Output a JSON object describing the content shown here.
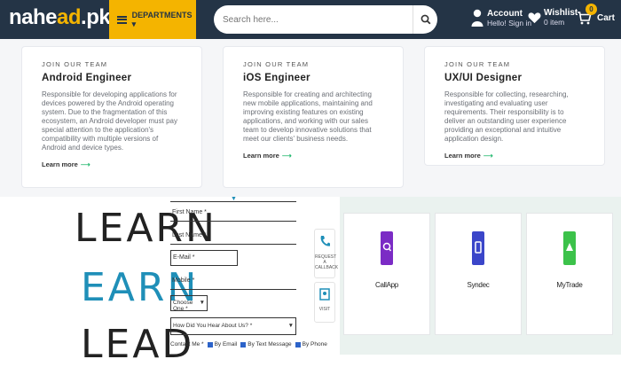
{
  "header": {
    "logo_main": "nahe",
    "logo_accent": "ad",
    "logo_tail": ".pk",
    "departments_label": "DEPARTMENTS ▾",
    "search_placeholder": "Search here...",
    "account_title": "Account",
    "account_sub": "Hello! Sign in",
    "wishlist_title": "Wishlist",
    "wishlist_sub": "0 item",
    "cart_label": "Cart",
    "cart_count": "0"
  },
  "jobs": [
    {
      "kicker": "JOIN OUR TEAM",
      "title": "Android Engineer",
      "desc": "Responsible for developing applications for devices powered by the Android operating system. Due to the fragmentation of this ecosystem, an Android developer must pay special attention to the application's compatibility with multiple versions of Android and device types.",
      "more": "Learn more"
    },
    {
      "kicker": "JOIN OUR TEAM",
      "title": "iOS Engineer",
      "desc": "Responsible for creating and architecting new mobile applications, maintaining and improving existing features on existing applications, and working with our sales team to develop innovative solutions that meet our clients' business needs.",
      "more": "Learn more"
    },
    {
      "kicker": "JOIN OUR TEAM",
      "title": "UX/UI Designer",
      "desc": "Responsible for collecting, researching, investigating and evaluating user requirements. Their responsibility is to deliver an outstanding user experience providing an exceptional and intuitive application design.",
      "more": "Learn more"
    }
  ],
  "promo": {
    "learn": "LEARN",
    "earn": "EARN",
    "lead": "LEAD"
  },
  "form": {
    "first_name": "First Name *",
    "last_name": "Last Name *",
    "email": "E-Mail *",
    "mobile": "Mobile *",
    "course": "Choose One *",
    "source": "How Did You Hear About Us? *",
    "contact_label": "Contact Me *",
    "opt_email": "By Email",
    "opt_text": "By Text Message",
    "opt_phone": "By Phone"
  },
  "side": {
    "request_callback": "REQUEST A CALLBACK",
    "visit": "VISIT"
  },
  "apps": [
    {
      "name": "CallApp",
      "color": "#7b2bc5"
    },
    {
      "name": "Syndec",
      "color": "#3b46c9"
    },
    {
      "name": "MyTrade",
      "color": "#3cc24a"
    }
  ]
}
